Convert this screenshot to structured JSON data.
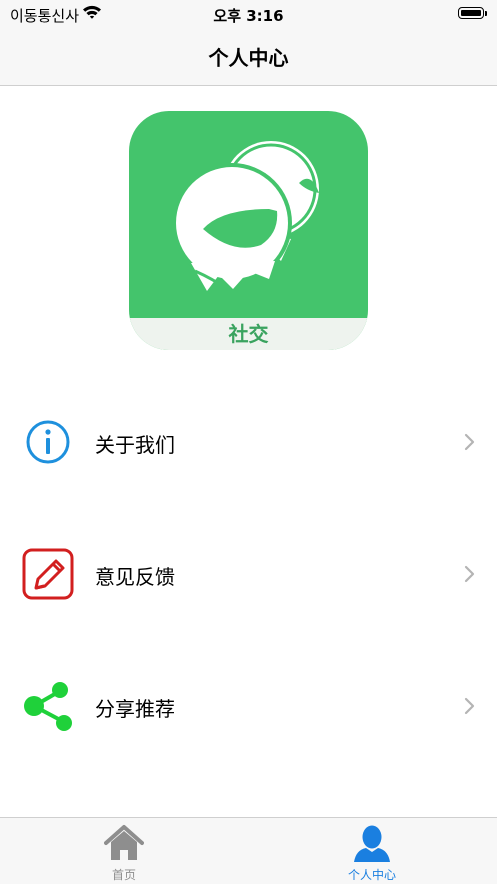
{
  "status_bar": {
    "carrier": "이동통신사",
    "time": "오후 3:16"
  },
  "nav": {
    "title": "个人中心"
  },
  "logo": {
    "caption": "社交",
    "icon": "chat-bubbles-logo",
    "color": "#44c46c"
  },
  "menu": [
    {
      "label": "关于我们",
      "icon": "info-icon",
      "color": "#1e90dd"
    },
    {
      "label": "意见反馈",
      "icon": "edit-feedback-icon",
      "color": "#d21f1f"
    },
    {
      "label": "分享推荐",
      "icon": "share-icon",
      "color": "#1fd13a"
    }
  ],
  "tab_bar": {
    "tabs": [
      {
        "label": "首页",
        "icon": "home-icon",
        "active": false
      },
      {
        "label": "个人中心",
        "icon": "person-icon",
        "active": true
      }
    ],
    "active_color": "#1a7fe0",
    "inactive_color": "#8e8e8e"
  }
}
